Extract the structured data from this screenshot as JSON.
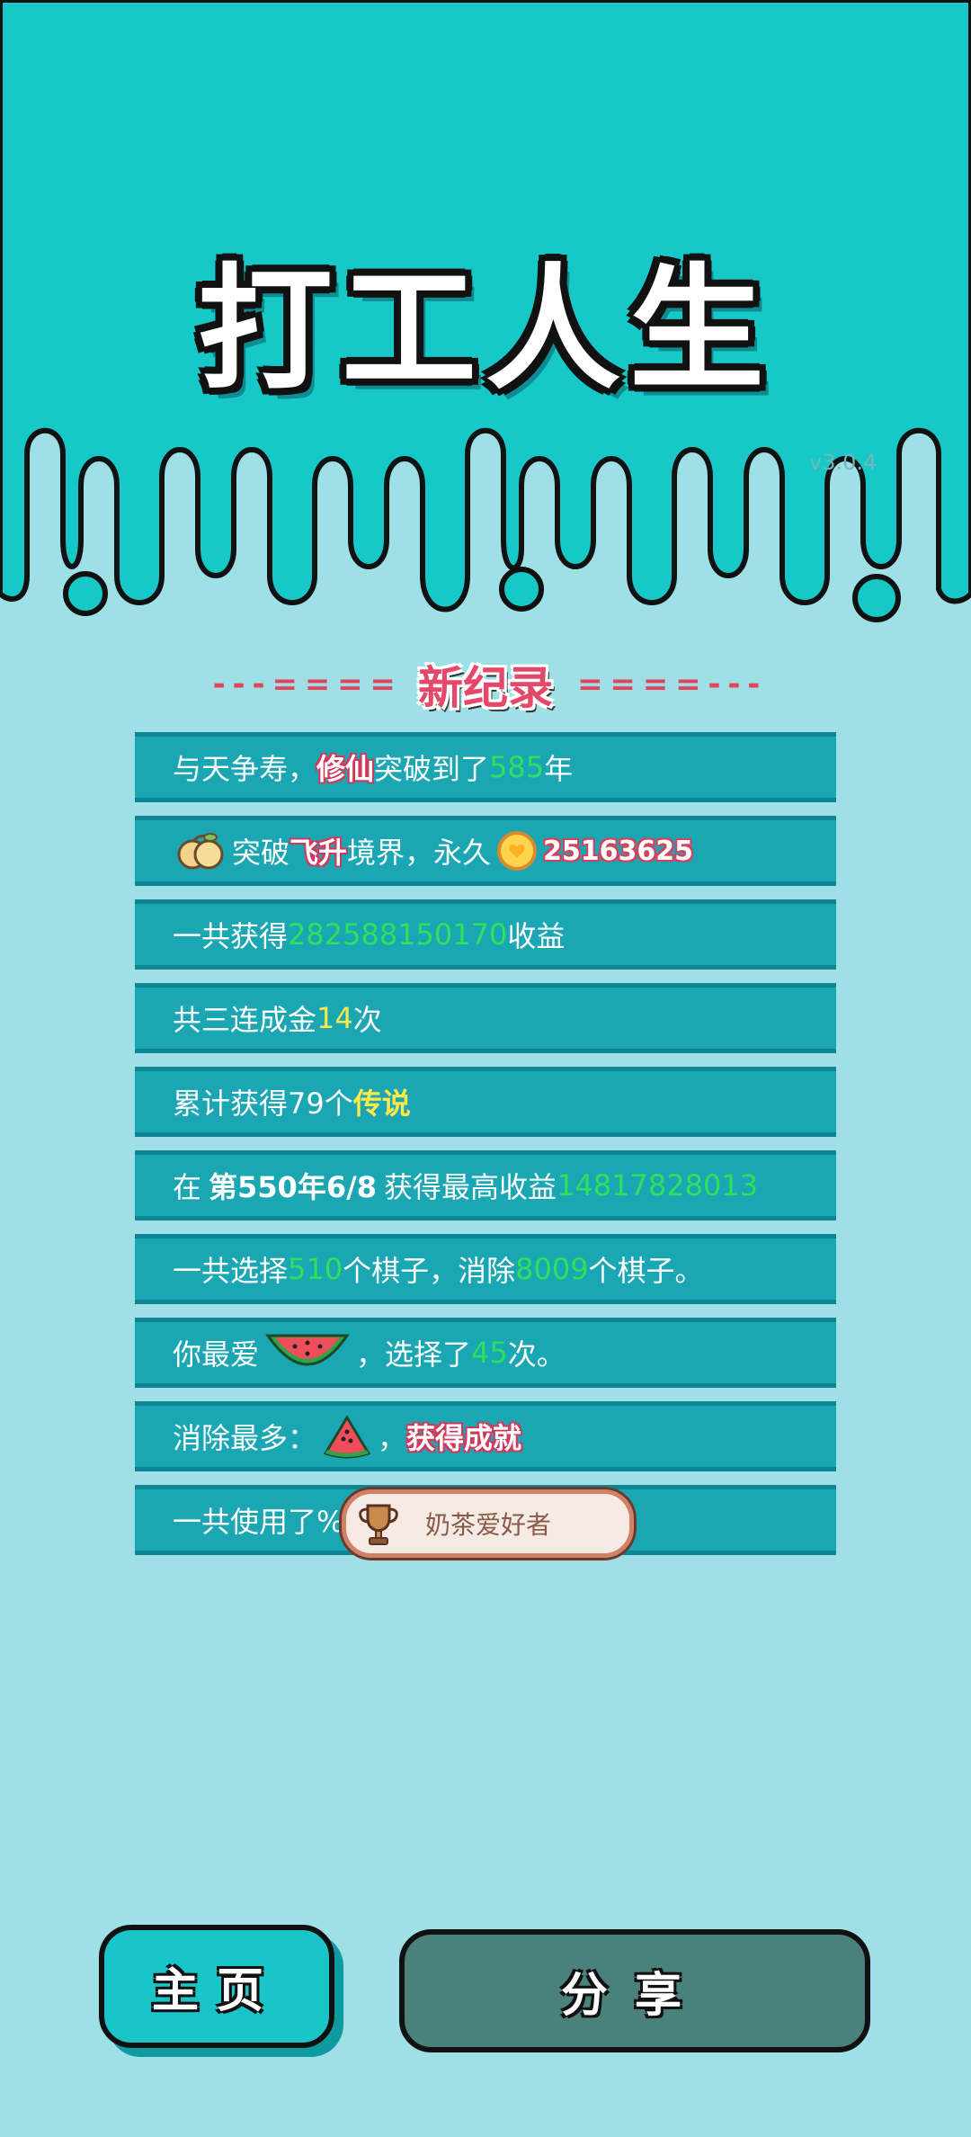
{
  "app": {
    "title": "打工人生",
    "version": "v3.0.4"
  },
  "records": {
    "header_dashes": "- - - = = = =",
    "header_dashes_right": "= = = = - - -",
    "title": "新纪录",
    "rows": [
      {
        "pre": "与天争寿，",
        "hl": "修仙",
        "mid": "突破到了",
        "num": "585",
        "post": "年"
      },
      {
        "pre": "突破",
        "hl": "飞升",
        "mid": "境界，永久",
        "num": "25163625"
      },
      {
        "pre": "一共获得",
        "num": "282588150170",
        "post": "收益"
      },
      {
        "pre": "共三连成金",
        "num": "14",
        "post": "次"
      },
      {
        "pre": "累计获得79个",
        "hl": "传说"
      },
      {
        "pre": "在",
        "bold": "第550年6/8",
        "mid": "获得最高收益",
        "num": "14817828013"
      },
      {
        "pre": "一共选择",
        "num": "510",
        "mid": "个棋子，消除",
        "num2": "8009",
        "post": "个棋子。"
      },
      {
        "pre": "你最爱",
        "mid": "，选择了",
        "num": "45",
        "post": "次。"
      },
      {
        "pre": "消除最多：",
        "mid": "，",
        "hl": "获得成就"
      },
      {
        "pre": "一共使用了%"
      }
    ]
  },
  "achievement_badge": {
    "label": "奶茶爱好者",
    "icon": "trophy-icon"
  },
  "buttons": {
    "home": "主页",
    "share": "分享"
  },
  "colors": {
    "top_band": "#16c8c8",
    "background": "#9fdfe6",
    "row": "#1aa6b3",
    "accent_red": "#e6486a",
    "number_green": "#2fe05c"
  }
}
